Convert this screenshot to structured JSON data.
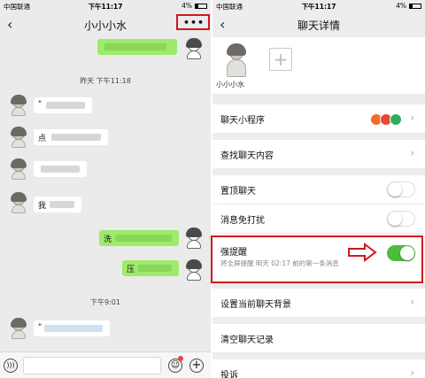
{
  "status": {
    "carrier": "中国联通",
    "time": "下午11:17",
    "battery": "4%"
  },
  "chat": {
    "title": "小小小水",
    "back_icon": "chevron-left-icon",
    "more_label": "•••",
    "timestamps": [
      "昨天 下午11:18",
      "下午9:01"
    ],
    "messages": [
      {
        "side": "out",
        "text": ""
      },
      {
        "side": "in",
        "text": "\""
      },
      {
        "side": "in",
        "text": "点"
      },
      {
        "side": "in",
        "text": ""
      },
      {
        "side": "in",
        "text": "我"
      },
      {
        "side": "out",
        "text": "洗"
      },
      {
        "side": "out",
        "text": "压"
      },
      {
        "side": "in",
        "text": "\""
      }
    ]
  },
  "input": {
    "voice_icon": "voice-icon",
    "emoji_icon": "emoji-icon",
    "plus_icon": "plus-icon"
  },
  "details": {
    "title": "聊天详情",
    "member_name": "小小小水",
    "add_label": "+",
    "rows": {
      "mini_programs": "聊天小程序",
      "search": "查找聊天内容",
      "pin": "置顶聊天",
      "mute": "消息免打扰",
      "strong_alert": "强提醒",
      "strong_alert_sub": "将全屏提醒 明天 02:17 前的第一条消息",
      "background": "设置当前聊天背景",
      "clear": "清空聊天记录",
      "report": "投诉"
    },
    "toggles": {
      "pin": false,
      "mute": false,
      "strong_alert": true
    },
    "app_icons": [
      "app-icon-1",
      "app-icon-2",
      "app-icon-3"
    ]
  },
  "colors": {
    "accent_green": "#4cbe3c",
    "bubble_green": "#9eea6a",
    "annotation_red": "#d0191a"
  }
}
